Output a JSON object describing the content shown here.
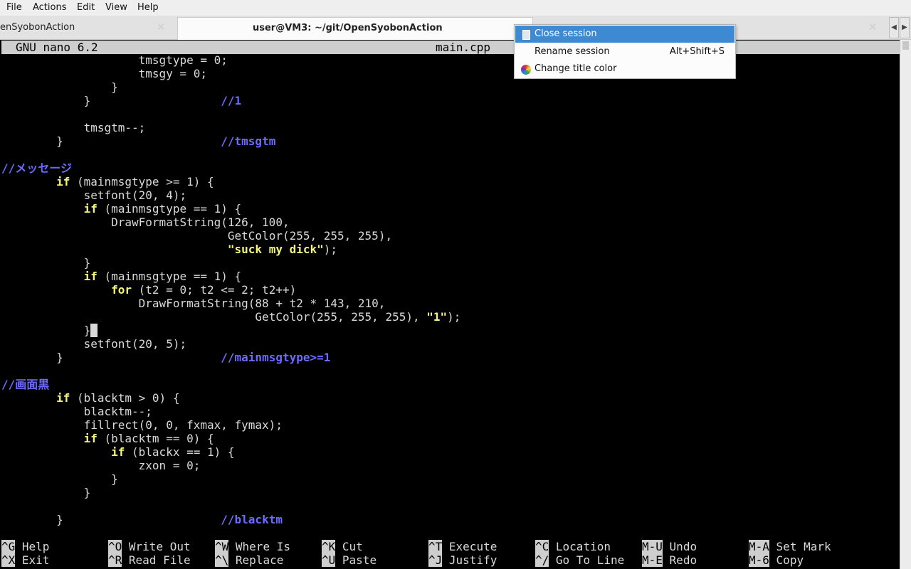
{
  "menubar": {
    "file": "File",
    "actions": "Actions",
    "edit": "Edit",
    "view": "View",
    "help": "Help"
  },
  "tabs": [
    {
      "label": "enSyobonAction"
    },
    {
      "label": "user@VM3: ~/git/OpenSyobonAction"
    },
    {
      "label": ""
    }
  ],
  "nano": {
    "version": "GNU nano 6.2",
    "filename": "main.cpp"
  },
  "code": {
    "l1": "tmsgtype = 0;",
    "l2": "tmsgy = 0;",
    "l3": "}",
    "l4_brace": "}",
    "l4_comment": "//1",
    "l6": "tmsgtm--;",
    "l7_brace": "}",
    "l7_comment": "//tmsgtm",
    "l9_comment": "//メッセージ",
    "l10_kw": "if",
    "l10_rest": " (mainmsgtype >= 1) {",
    "l11": "setfont(20, 4);",
    "l12_kw": "if",
    "l12_rest": " (mainmsgtype == 1) {",
    "l13": "DrawFormatString(126, 100,",
    "l14": "GetColor(255, 255, 255),",
    "l15_str": "\"suck my dick\"",
    "l15_rest": ");",
    "l16": "}",
    "l17_kw": "if",
    "l17_rest": " (mainmsgtype == 1) {",
    "l18_kw": "for",
    "l18_rest": " (t2 = 0; t2 <= 2; t2++)",
    "l19": "DrawFormatString(88 + t2 * 143, 210,",
    "l20_a": "GetColor(255, 255, 255), ",
    "l20_str": "\"1\"",
    "l20_b": ");",
    "l21": "}",
    "l22": "setfont(20, 5);",
    "l23_brace": "}",
    "l23_comment": "//mainmsgtype>=1",
    "l25_comment": "//画面黒",
    "l26_kw": "if",
    "l26_rest": " (blacktm > 0) {",
    "l27": "blacktm--;",
    "l28": "fillrect(0, 0, fxmax, fymax);",
    "l29_kw": "if",
    "l29_rest": " (blacktm == 0) {",
    "l30_kw": "if",
    "l30_rest": " (blackx == 1) {",
    "l31": "zxon = 0;",
    "l32": "}",
    "l33": "}",
    "l35_brace": "}",
    "l35_comment": "//blacktm"
  },
  "shortcuts": [
    {
      "key1": "^G",
      "label1": "Help",
      "key2": "^X",
      "label2": "Exit"
    },
    {
      "key1": "^O",
      "label1": "Write Out",
      "key2": "^R",
      "label2": "Read File"
    },
    {
      "key1": "^W",
      "label1": "Where Is",
      "key2": "^\\",
      "label2": "Replace"
    },
    {
      "key1": "^K",
      "label1": "Cut",
      "key2": "^U",
      "label2": "Paste"
    },
    {
      "key1": "^T",
      "label1": "Execute",
      "key2": "^J",
      "label2": "Justify"
    },
    {
      "key1": "^C",
      "label1": "Location",
      "key2": "^/",
      "label2": "Go To Line"
    },
    {
      "key1": "M-U",
      "label1": "Undo",
      "key2": "M-E",
      "label2": "Redo"
    },
    {
      "key1": "M-A",
      "label1": "Set Mark",
      "key2": "M-6",
      "label2": "Copy"
    }
  ],
  "context_menu": {
    "close": "Close session",
    "rename": "Rename session",
    "rename_shortcut": "Alt+Shift+S",
    "color": "Change title color"
  },
  "colors": {
    "keyword": "#f5f57a",
    "comment": "#6b6bff",
    "menu_highlight": "#3d8ad3",
    "terminal_bg": "#000000"
  }
}
